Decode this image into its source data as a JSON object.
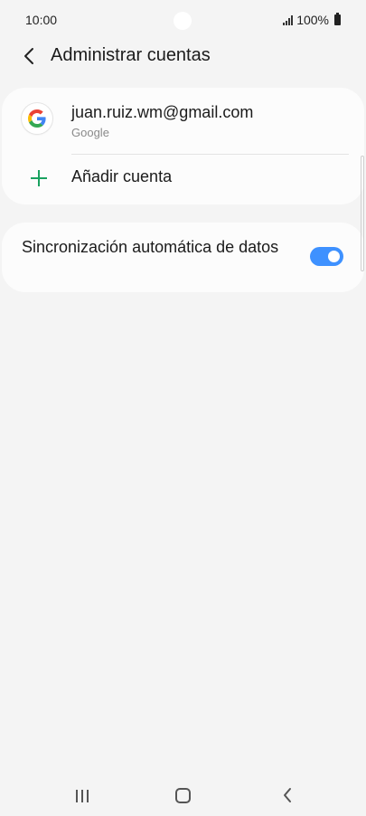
{
  "status_bar": {
    "time": "10:00",
    "battery": "100%",
    "signal_icon": "signal-icon",
    "battery_icon": "battery-icon"
  },
  "header": {
    "title": "Administrar cuentas",
    "back_icon": "chevron-left-icon"
  },
  "accounts": {
    "items": [
      {
        "email": "juan.ruiz.wm@gmail.com",
        "type": "Google",
        "icon": "google-icon"
      }
    ],
    "add_label": "Añadir cuenta",
    "add_icon": "plus-icon"
  },
  "sync": {
    "label": "Sincronización automática de datos",
    "enabled": true
  },
  "colors": {
    "accent": "#3e91ff",
    "add_icon": "#1aa260",
    "background": "#f4f4f4",
    "card": "#fcfcfc"
  },
  "nav_bar": {
    "recent_icon": "recent-apps-icon",
    "home_icon": "home-icon",
    "back_icon": "back-icon"
  }
}
